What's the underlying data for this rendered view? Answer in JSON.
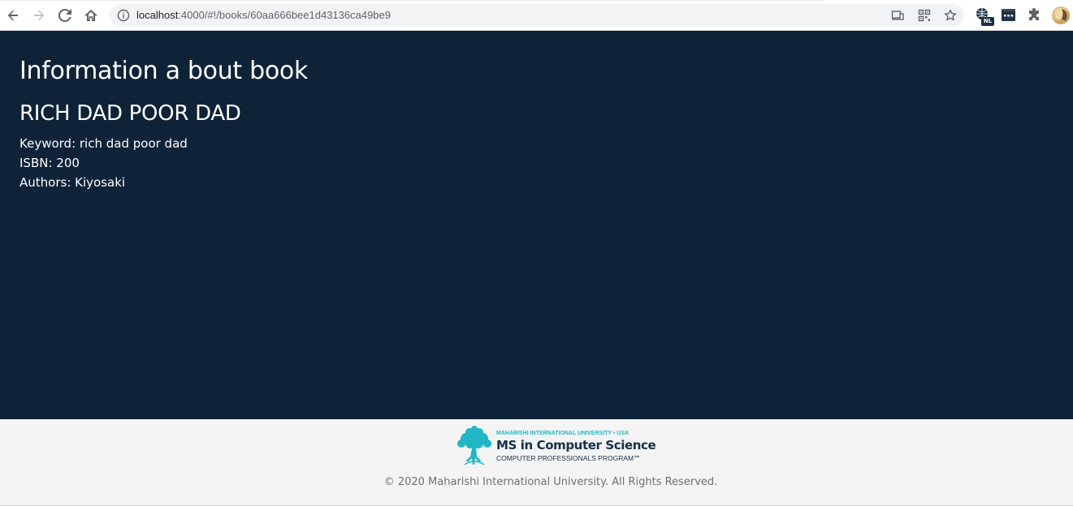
{
  "browser": {
    "url_host": "localhost",
    "url_rest": ":4000/#!/books/60aa666bee1d43136ca49be9",
    "language_badge": "NL",
    "icons": {
      "back": "back-arrow-icon",
      "forward": "forward-arrow-icon",
      "reload": "reload-icon",
      "home": "home-icon",
      "site_info": "info-icon",
      "cast": "cast-icon",
      "qr": "qr-code-icon",
      "bookmark": "star-icon",
      "translate": "globe-icon",
      "extension": "ellipsis-extension-icon",
      "extensions_menu": "puzzle-icon",
      "profile": "avatar"
    }
  },
  "page": {
    "heading": "Information a bout book",
    "book": {
      "title": "RICH DAD POOR DAD",
      "keyword_line": "Keyword: rich dad poor dad",
      "isbn_line": "ISBN: 200",
      "authors_line": "Authors: Kiyosaki"
    }
  },
  "footer": {
    "logo": {
      "university": "MAHARISHI INTERNATIONAL UNIVERSITY • USA",
      "program": "MS in Computer Science",
      "subprogram": "COMPUTER PROFESSIONALS PROGRAM℠"
    },
    "copyright": "© 2020 Maharishi International University. All Rights Reserved."
  },
  "colors": {
    "page_background": "#0f2338",
    "footer_background": "#f4f4f4",
    "logo_teal": "#20b6c6",
    "logo_navy": "#15304a"
  }
}
